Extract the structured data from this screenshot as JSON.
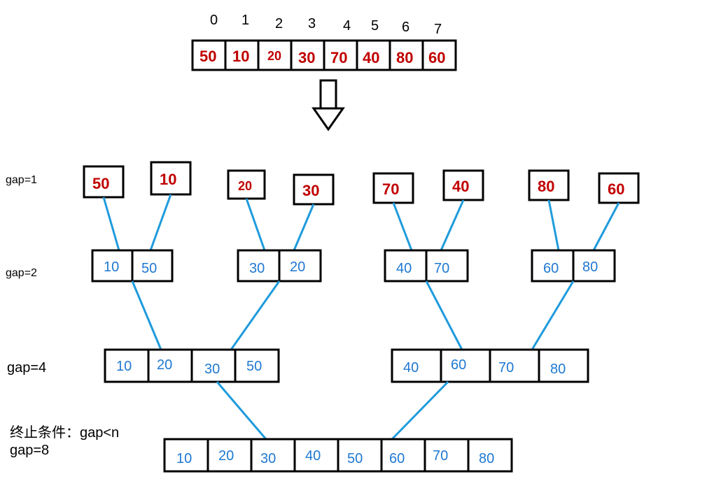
{
  "indices": [
    "0",
    "1",
    "2",
    "3",
    "4",
    "5",
    "6",
    "7"
  ],
  "top_array": [
    "50",
    "10",
    "20",
    "30",
    "70",
    "40",
    "80",
    "60"
  ],
  "labels": {
    "gap1": "gap=1",
    "gap2": "gap=2",
    "gap4": "gap=4",
    "gap8": "gap=8",
    "terminate": "终止条件：gap<n"
  },
  "row_gap1": [
    "50",
    "10",
    "20",
    "30",
    "70",
    "40",
    "80",
    "60"
  ],
  "row_gap2": [
    [
      "10",
      "50"
    ],
    [
      "30",
      "20"
    ],
    [
      "40",
      "70"
    ],
    [
      "60",
      "80"
    ]
  ],
  "row_gap4": [
    [
      "10",
      "20",
      "30",
      "50"
    ],
    [
      "40",
      "60",
      "70",
      "80"
    ]
  ],
  "row_gap8": [
    "10",
    "20",
    "30",
    "40",
    "50",
    "60",
    "70",
    "80"
  ],
  "chart_data": {
    "type": "table",
    "title": "Merge sort bottom-up passes (gap doubling) on 8 elements",
    "n": 8,
    "initial": [
      50,
      10,
      20,
      30,
      70,
      40,
      80,
      60
    ],
    "passes": [
      {
        "gap": 1,
        "groups": [
          [
            50
          ],
          [
            10
          ],
          [
            20
          ],
          [
            30
          ],
          [
            70
          ],
          [
            40
          ],
          [
            80
          ],
          [
            60
          ]
        ]
      },
      {
        "gap": 2,
        "groups": [
          [
            10,
            50
          ],
          [
            30,
            20
          ],
          [
            40,
            70
          ],
          [
            60,
            80
          ]
        ]
      },
      {
        "gap": 4,
        "groups": [
          [
            10,
            20,
            30,
            50
          ],
          [
            40,
            60,
            70,
            80
          ]
        ]
      },
      {
        "gap": 8,
        "groups": [
          [
            10,
            20,
            30,
            40,
            50,
            60,
            70,
            80
          ]
        ]
      }
    ],
    "terminate_condition": "gap < n"
  }
}
